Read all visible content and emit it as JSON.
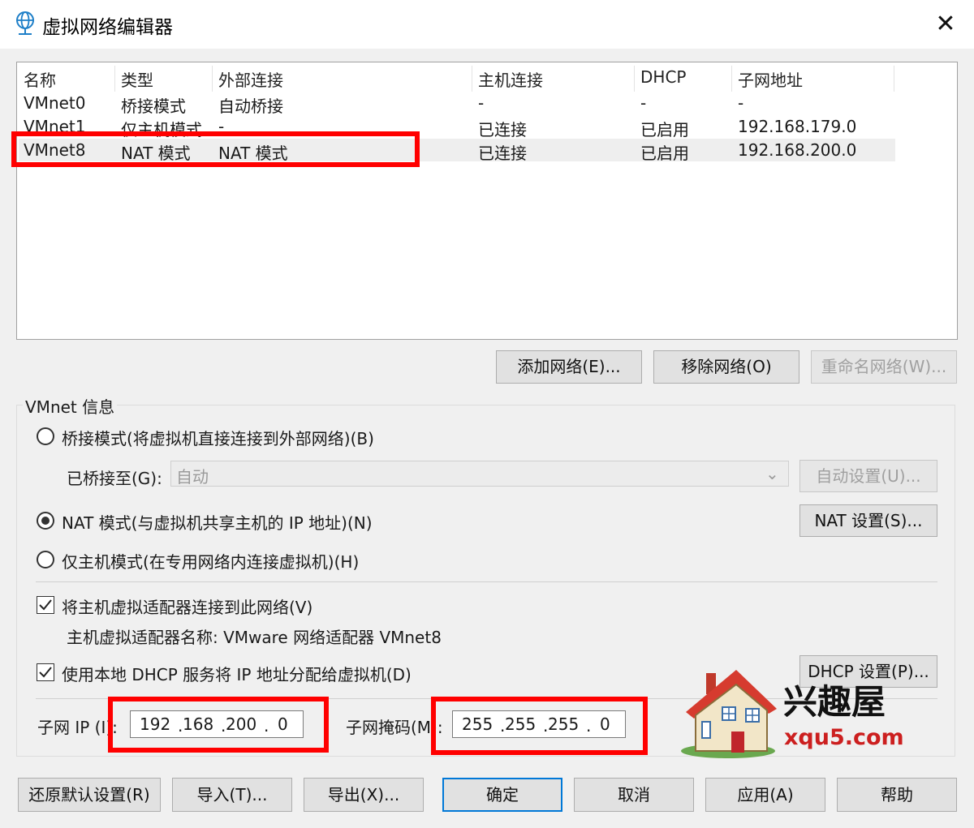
{
  "window": {
    "title": "虚拟网络编辑器",
    "close_glyph": "✕",
    "icon": "globe-network-icon"
  },
  "list": {
    "columns": [
      "名称",
      "类型",
      "外部连接",
      "主机连接",
      "DHCP",
      "子网地址"
    ],
    "rows": [
      {
        "name": "VMnet0",
        "type": "桥接模式",
        "external": "自动桥接",
        "host": "-",
        "dhcp": "-",
        "subnet": "-"
      },
      {
        "name": "VMnet1",
        "type": "仅主机模式",
        "external": "-",
        "host": "已连接",
        "dhcp": "已启用",
        "subnet": "192.168.179.0"
      },
      {
        "name": "VMnet8",
        "type": "NAT 模式",
        "external": "NAT 模式",
        "host": "已连接",
        "dhcp": "已启用",
        "subnet": "192.168.200.0"
      }
    ]
  },
  "list_buttons": {
    "add": "添加网络(E)...",
    "remove": "移除网络(O)",
    "rename": "重命名网络(W)..."
  },
  "vmnet_info": {
    "title": "VMnet 信息",
    "bridged_label": "桥接模式(将虚拟机直接连接到外部网络)(B)",
    "bridged_to_label": "已桥接至(G):",
    "bridged_to_value": "自动",
    "auto_settings": "自动设置(U)...",
    "nat_label": "NAT 模式(与虚拟机共享主机的 IP 地址)(N)",
    "nat_settings": "NAT 设置(S)...",
    "hostonly_label": "仅主机模式(在专用网络内连接虚拟机)(H)",
    "connect_adapter_label": "将主机虚拟适配器连接到此网络(V)",
    "adapter_name_text": "主机虚拟适配器名称: VMware 网络适配器 VMnet8",
    "dhcp_label": "使用本地 DHCP 服务将 IP 地址分配给虚拟机(D)",
    "dhcp_settings": "DHCP 设置(P)...",
    "subnet_ip_label": "子网 IP (I):",
    "subnet_ip": [
      "192",
      "168",
      "200",
      "0"
    ],
    "subnet_mask_label": "子网掩码(M):",
    "subnet_mask": [
      "255",
      "255",
      "255",
      "0"
    ],
    "selected_mode": "nat",
    "connect_adapter_checked": true,
    "dhcp_checked": true
  },
  "bottom_buttons": {
    "restore": "还原默认设置(R)",
    "import": "导入(T)...",
    "export": "导出(X)...",
    "ok": "确定",
    "cancel": "取消",
    "apply": "应用(A)",
    "help": "帮助"
  },
  "watermark": {
    "brand": "兴趣屋",
    "url": "xqu5.com",
    "icon": "house-icon"
  },
  "colors": {
    "highlight": "#ff0000",
    "accent": "#0078d7"
  }
}
